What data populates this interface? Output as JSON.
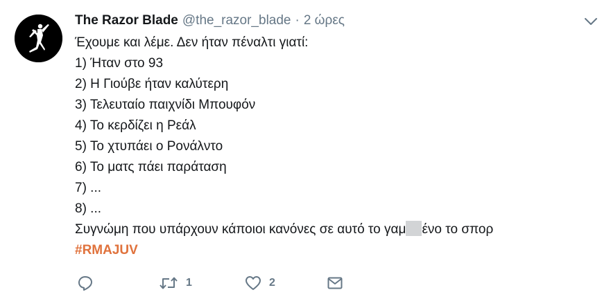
{
  "tweet": {
    "author": {
      "name": "The Razor Blade",
      "handle": "@the_razor_blade",
      "avatar_icon": "jumpman-logo-icon"
    },
    "separator": "·",
    "time": "2 ώρες",
    "lines": [
      "Έχουμε και λέμε. Δεν ήταν πέναλτι γιατί:",
      "1) Ήταν στο 93",
      "2) Η Γιούβε ήταν καλύτερη",
      "3) Τελευταίο παιχνίδι Μπουφόν",
      "4) Το κερδίζει η Ρεάλ",
      "5) Το χτυπάει ο Ρονάλντο",
      "6) Το ματς πάει παράταση",
      "7) ...",
      "8) ..."
    ],
    "last_line": {
      "before": "Συγνώμη που υπάρχουν κάποιοι κανόνες σε αυτό το γαμ",
      "after": "ένο το σπορ"
    },
    "hashtag": "#RMAJUV",
    "actions": {
      "reply_icon": "reply-icon",
      "retweet_icon": "retweet-icon",
      "retweet_count": "1",
      "like_icon": "heart-icon",
      "like_count": "2",
      "dm_icon": "envelope-icon"
    }
  },
  "colors": {
    "text": "#14171a",
    "muted": "#657786",
    "hashtag": "#e0723c",
    "censor": "#d2d4d6"
  }
}
